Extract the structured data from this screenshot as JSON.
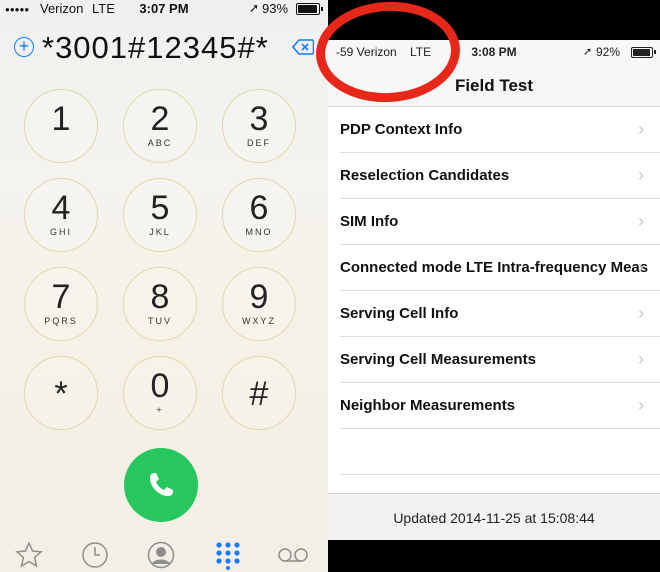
{
  "dialer": {
    "status": {
      "carrier": "Verizon",
      "network": "LTE",
      "time": "3:07 PM",
      "battery": "93%",
      "battery_level": 0.93
    },
    "number": "*3001#12345#*",
    "keys": [
      {
        "digit": "1",
        "letters": ""
      },
      {
        "digit": "2",
        "letters": "ABC"
      },
      {
        "digit": "3",
        "letters": "DEF"
      },
      {
        "digit": "4",
        "letters": "GHI"
      },
      {
        "digit": "5",
        "letters": "JKL"
      },
      {
        "digit": "6",
        "letters": "MNO"
      },
      {
        "digit": "7",
        "letters": "PQRS"
      },
      {
        "digit": "8",
        "letters": "TUV"
      },
      {
        "digit": "9",
        "letters": "WXYZ"
      },
      {
        "digit": "*",
        "letters": ""
      },
      {
        "digit": "0",
        "letters": "+"
      },
      {
        "digit": "#",
        "letters": ""
      }
    ],
    "call_color": "#27c65f",
    "accent": "#1a7bff",
    "tabs": [
      "star-icon",
      "clock-icon",
      "contact-icon",
      "keypad-icon",
      "voicemail-icon"
    ]
  },
  "field_test": {
    "status": {
      "carrier": "-59 Verizon",
      "network": "LTE",
      "time": "3:08 PM",
      "battery": "92%",
      "battery_level": 0.92
    },
    "title": "Field Test",
    "items": [
      "PDP Context Info",
      "Reselection Candidates",
      "SIM Info",
      "Connected mode LTE Intra-frequency Meas",
      "Serving Cell Info",
      "Serving Cell Measurements",
      "Neighbor Measurements"
    ],
    "updated": "Updated 2014-11-25 at 15:08:44",
    "highlight_color": "#e8271b"
  }
}
